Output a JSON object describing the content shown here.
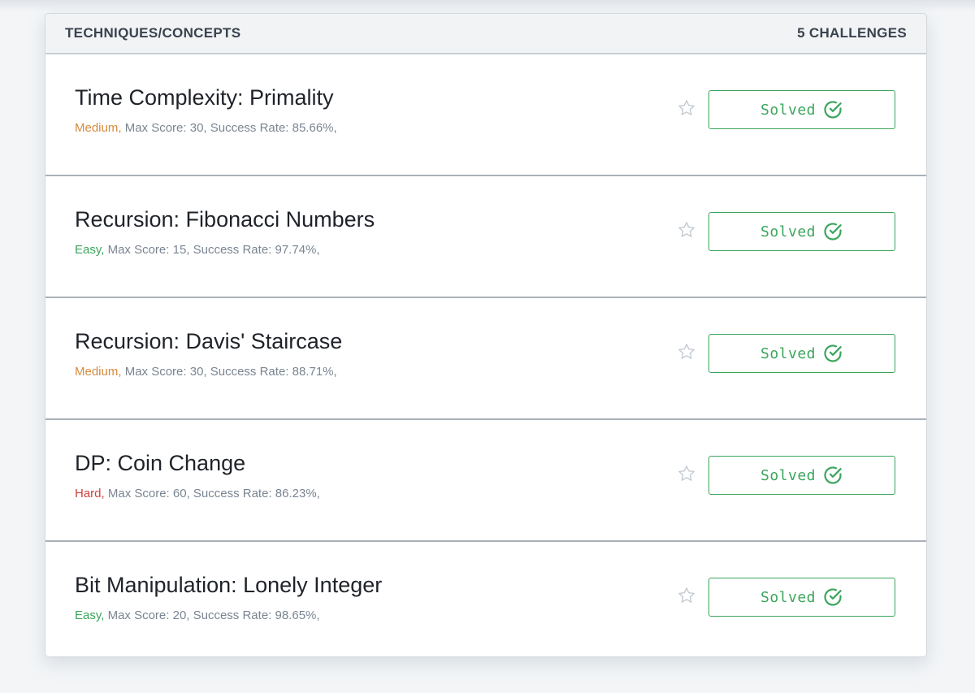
{
  "header": {
    "title": "TECHNIQUES/CONCEPTS",
    "count": "5 CHALLENGES"
  },
  "icons": {
    "star": "star-outline-icon",
    "check": "circle-check-icon"
  },
  "colors": {
    "medium": "#d68a3c",
    "easy": "#3ca55c",
    "hard": "#d0413d",
    "solved": "#3ca55c"
  },
  "challenges": [
    {
      "title": "Time Complexity: Primality",
      "difficulty": "Medium,",
      "details": "Max Score: 30, Success Rate: 85.66%,",
      "status": "Solved"
    },
    {
      "title": "Recursion: Fibonacci Numbers",
      "difficulty": "Easy,",
      "details": "Max Score: 15, Success Rate: 97.74%,",
      "status": "Solved"
    },
    {
      "title": "Recursion: Davis' Staircase",
      "difficulty": "Medium,",
      "details": "Max Score: 30, Success Rate: 88.71%,",
      "status": "Solved"
    },
    {
      "title": "DP: Coin Change",
      "difficulty": "Hard,",
      "details": "Max Score: 60, Success Rate: 86.23%,",
      "status": "Solved"
    },
    {
      "title": "Bit Manipulation: Lonely Integer",
      "difficulty": "Easy,",
      "details": "Max Score: 20, Success Rate: 98.65%,",
      "status": "Solved"
    }
  ]
}
